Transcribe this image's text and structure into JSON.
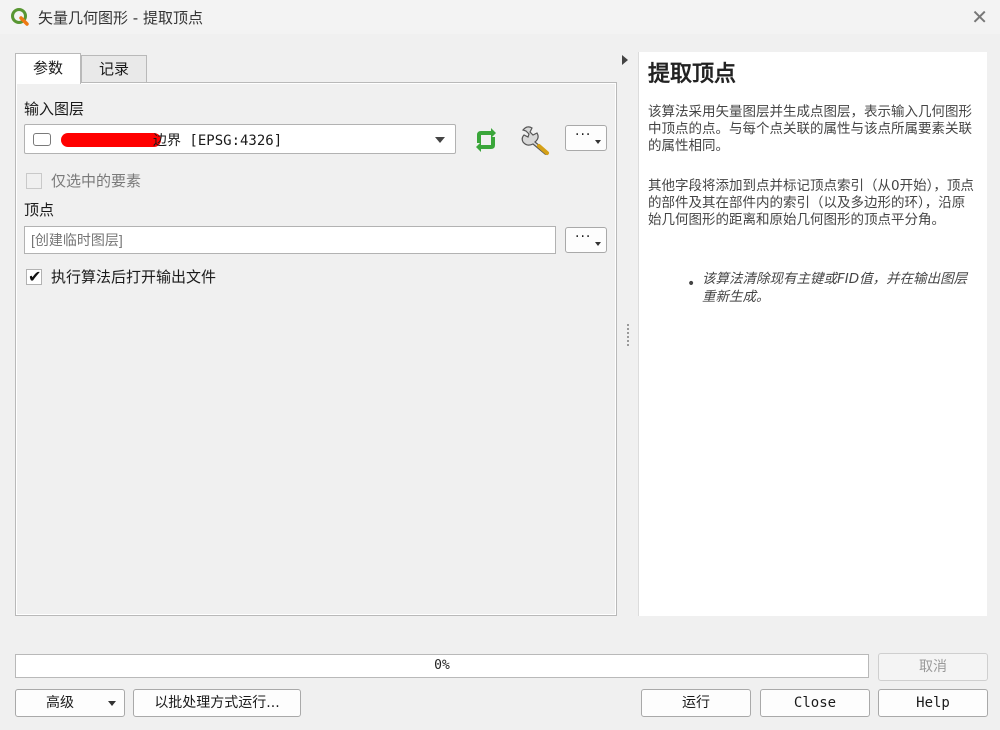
{
  "window": {
    "title": "矢量几何图形 - 提取顶点",
    "close_symbol": "✕",
    "logo_icon": "qgis-logo-icon"
  },
  "tabs": [
    {
      "label": "参数",
      "active": true
    },
    {
      "label": "记录",
      "active": false
    }
  ],
  "params": {
    "input_layer_label": "输入图层",
    "input_layer_value": "边界 [EPSG:4326]",
    "selected_only_label": "仅选中的要素",
    "selected_only_checked": false,
    "selected_only_enabled": false,
    "vertices_label": "顶点",
    "vertices_placeholder": "[创建临时图层]",
    "open_output_label": "执行算法后打开输出文件",
    "open_output_checked": true,
    "more_label": "···"
  },
  "help": {
    "title": "提取顶点",
    "paragraph1": "该算法采用矢量图层并生成点图层，表示输入几何图形中顶点的点。与每个点关联的属性与该点所属要素关联的属性相同。",
    "paragraph2": "其他字段将添加到点并标记顶点索引（从0开始），顶点的部件及其在部件内的索引（以及多边形的环），沿原始几何图形的距离和原始几何图形的顶点平分角。",
    "bullet": "该算法清除现有主键或FID值，并在输出图层重新生成。"
  },
  "progress": {
    "text": "0%",
    "value": 0
  },
  "buttons": {
    "cancel": "取消",
    "advanced": "高级",
    "batch": "以批处理方式运行...",
    "run": "运行",
    "close": "Close",
    "help": "Help"
  },
  "colors": {
    "accent_green": "#3aa63a",
    "redaction": "#ff0000"
  }
}
